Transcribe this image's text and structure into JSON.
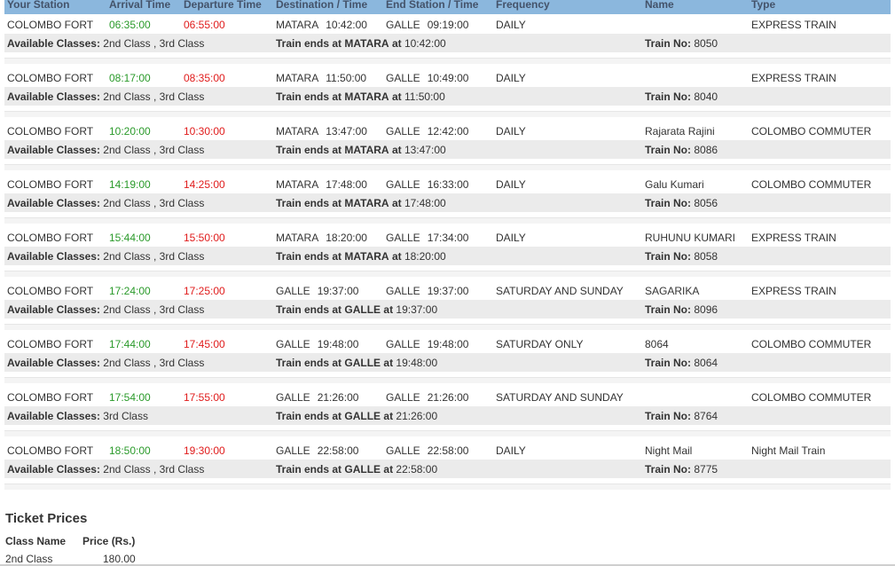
{
  "headers": {
    "station": "Your Station",
    "arrival": "Arrival Time",
    "departure": "Departure Time",
    "destination": "Destination / Time",
    "end": "End Station / Time",
    "frequency": "Frequency",
    "name": "Name",
    "type": "Type"
  },
  "labels": {
    "available_classes": "Available Classes:",
    "train_ends_at": "Train ends at",
    "at": "at",
    "train_no": "Train No:"
  },
  "trains": [
    {
      "station": "COLOMBO FORT",
      "arrival": "06:35:00",
      "departure": "06:55:00",
      "dest": "MATARA",
      "dest_time": "10:42:00",
      "end": "GALLE",
      "end_time": "09:19:00",
      "frequency": "DAILY",
      "name": "",
      "type": "EXPRESS TRAIN",
      "classes": "2nd Class ,  3rd Class",
      "ends_station": "MATARA",
      "ends_time": "10:42:00",
      "train_no": "8050"
    },
    {
      "station": "COLOMBO FORT",
      "arrival": "08:17:00",
      "departure": "08:35:00",
      "dest": "MATARA",
      "dest_time": "11:50:00",
      "end": "GALLE",
      "end_time": "10:49:00",
      "frequency": "DAILY",
      "name": "",
      "type": "EXPRESS TRAIN",
      "classes": "2nd Class ,  3rd Class",
      "ends_station": "MATARA",
      "ends_time": "11:50:00",
      "train_no": "8040"
    },
    {
      "station": "COLOMBO FORT",
      "arrival": "10:20:00",
      "departure": "10:30:00",
      "dest": "MATARA",
      "dest_time": "13:47:00",
      "end": "GALLE",
      "end_time": "12:42:00",
      "frequency": "DAILY",
      "name": "Rajarata Rajini",
      "type": "COLOMBO COMMUTER",
      "classes": "2nd Class ,  3rd Class",
      "ends_station": "MATARA",
      "ends_time": "13:47:00",
      "train_no": "8086"
    },
    {
      "station": "COLOMBO FORT",
      "arrival": "14:19:00",
      "departure": "14:25:00",
      "dest": "MATARA",
      "dest_time": "17:48:00",
      "end": "GALLE",
      "end_time": "16:33:00",
      "frequency": "DAILY",
      "name": "Galu Kumari",
      "type": "COLOMBO COMMUTER",
      "classes": "2nd Class ,  3rd Class",
      "ends_station": "MATARA",
      "ends_time": "17:48:00",
      "train_no": "8056"
    },
    {
      "station": "COLOMBO FORT",
      "arrival": "15:44:00",
      "departure": "15:50:00",
      "dest": "MATARA",
      "dest_time": "18:20:00",
      "end": "GALLE",
      "end_time": "17:34:00",
      "frequency": "DAILY",
      "name": "RUHUNU KUMARI",
      "type": "EXPRESS TRAIN",
      "classes": "2nd Class ,  3rd Class",
      "ends_station": "MATARA",
      "ends_time": "18:20:00",
      "train_no": "8058"
    },
    {
      "station": "COLOMBO FORT",
      "arrival": "17:24:00",
      "departure": "17:25:00",
      "dest": "GALLE",
      "dest_time": "19:37:00",
      "end": "GALLE",
      "end_time": "19:37:00",
      "frequency": "SATURDAY AND SUNDAY",
      "name": "SAGARIKA",
      "type": "EXPRESS TRAIN",
      "classes": "2nd Class ,  3rd Class",
      "ends_station": "GALLE",
      "ends_time": "19:37:00",
      "train_no": "8096"
    },
    {
      "station": "COLOMBO FORT",
      "arrival": "17:44:00",
      "departure": "17:45:00",
      "dest": "GALLE",
      "dest_time": "19:48:00",
      "end": "GALLE",
      "end_time": "19:48:00",
      "frequency": "SATURDAY ONLY",
      "name": "8064",
      "type": "COLOMBO COMMUTER",
      "classes": "2nd Class ,  3rd Class",
      "ends_station": "GALLE",
      "ends_time": "19:48:00",
      "train_no": "8064"
    },
    {
      "station": "COLOMBO FORT",
      "arrival": "17:54:00",
      "departure": "17:55:00",
      "dest": "GALLE",
      "dest_time": "21:26:00",
      "end": "GALLE",
      "end_time": "21:26:00",
      "frequency": "SATURDAY AND SUNDAY",
      "name": "",
      "type": "COLOMBO COMMUTER",
      "classes": "3rd Class",
      "ends_station": "GALLE",
      "ends_time": "21:26:00",
      "train_no": "8764"
    },
    {
      "station": "COLOMBO FORT",
      "arrival": "18:50:00",
      "departure": "19:30:00",
      "dest": "GALLE",
      "dest_time": "22:58:00",
      "end": "GALLE",
      "end_time": "22:58:00",
      "frequency": "DAILY",
      "name": "Night Mail",
      "type": "Night Mail Train",
      "classes": "2nd Class ,  3rd Class",
      "ends_station": "GALLE",
      "ends_time": "22:58:00",
      "train_no": "8775"
    }
  ],
  "ticket_prices": {
    "title": "Ticket Prices",
    "class_header": "Class Name",
    "price_header": "Price (Rs.)",
    "rows": [
      {
        "class_name": "2nd Class",
        "price": "180.00"
      }
    ]
  }
}
